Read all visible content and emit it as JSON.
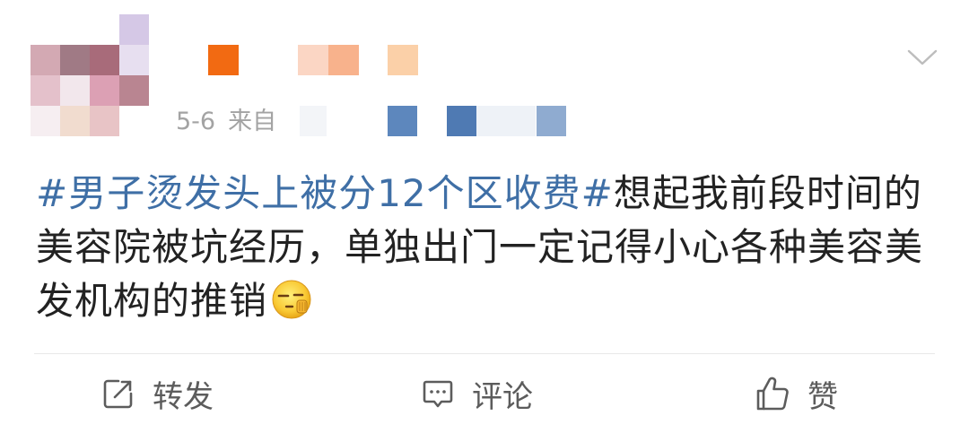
{
  "post": {
    "date": "5-6",
    "source_prefix": "来自",
    "hashtag": "#男子烫发头上被分12个区收费#",
    "body": "想起我前段时间的美容院被坑经历，单独出门一定记得小心各种美容美发机构的推销",
    "emoji": "smirk-hand-emoji"
  },
  "actions": {
    "repost_label": "转发",
    "comment_label": "评论",
    "like_label": "赞",
    "repost_icon": "repost-icon",
    "comment_icon": "comment-icon",
    "like_icon": "thumbs-up-icon"
  },
  "menu_icon": "chevron-down-icon",
  "colors": {
    "hashtag": "#3f6fa6",
    "text": "#222222",
    "meta": "#a3a3a3",
    "action": "#5c5c5c",
    "divider": "#e8e8e8"
  }
}
